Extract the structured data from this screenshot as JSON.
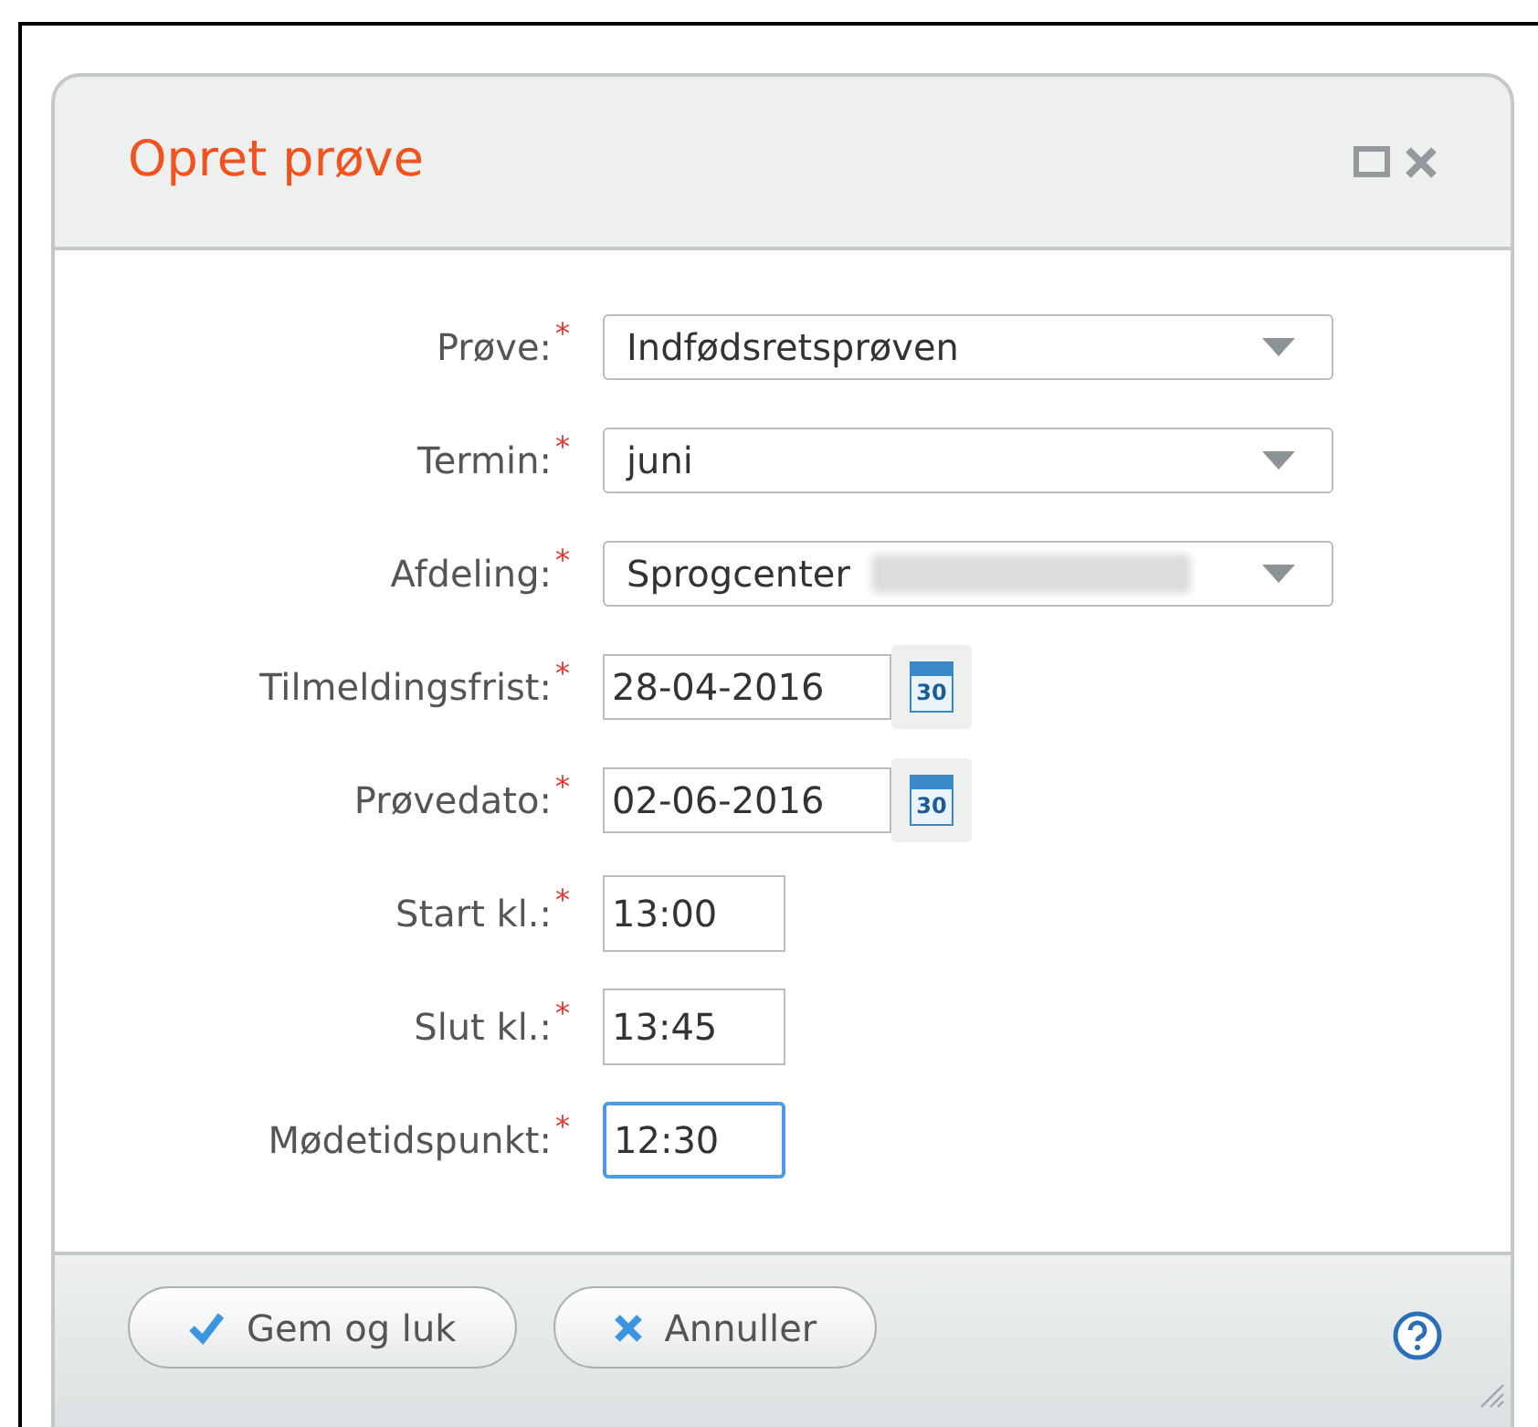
{
  "dialog": {
    "title": "Opret prøve"
  },
  "fields": [
    {
      "kind": "select",
      "label": "Prøve:",
      "required_mark": "*",
      "value": "Indfødsretsprøven",
      "redacted": false
    },
    {
      "kind": "select",
      "label": "Termin:",
      "required_mark": "*",
      "value": "juni",
      "redacted": false
    },
    {
      "kind": "select",
      "label": "Afdeling:",
      "required_mark": "*",
      "value": "Sprogcenter",
      "redacted": true
    },
    {
      "kind": "date",
      "label": "Tilmeldingsfrist:",
      "required_mark": "*",
      "value": "28-04-2016",
      "icon_day": "30"
    },
    {
      "kind": "date",
      "label": "Prøvedato:",
      "required_mark": "*",
      "value": "02-06-2016",
      "icon_day": "30"
    },
    {
      "kind": "time",
      "label": "Start kl.:",
      "required_mark": "*",
      "value": "13:00",
      "focused": false
    },
    {
      "kind": "time",
      "label": "Slut kl.:",
      "required_mark": "*",
      "value": "13:45",
      "focused": false
    },
    {
      "kind": "time",
      "label": "Mødetidspunkt:",
      "required_mark": "*",
      "value": "12:30",
      "focused": true
    }
  ],
  "buttons": [
    {
      "kind": "save",
      "label": "Gem og luk"
    },
    {
      "kind": "cancel",
      "label": "Annuller"
    }
  ]
}
